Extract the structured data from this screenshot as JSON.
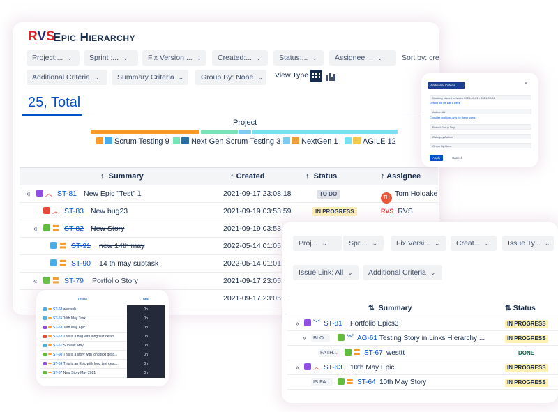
{
  "app": {
    "logo": {
      "r": "R",
      "v": "V",
      "s": "S"
    },
    "title": "Epic Hierarchy"
  },
  "filters": [
    "Project:...",
    "Sprint :...",
    "Fix Version ...",
    "Created:...",
    "Status:...",
    "Assignee ...",
    "Sort by: cre"
  ],
  "filters2": [
    "Additional Criteria",
    "Summary Criteria",
    "Group By: None"
  ],
  "view_type_label": "View Type",
  "total": "25, Total",
  "project": {
    "label": "Project",
    "legend": [
      {
        "name": "Scrum Testing",
        "count": "9",
        "color": "#f79a2a",
        "icon": "scrum-project-icon"
      },
      {
        "name": "Next Gen Scrum Testing",
        "count": "3",
        "color": "#79e2b6",
        "icon": "nextgen-scrum-project-icon"
      },
      {
        "name": "NextGen",
        "count": "1",
        "color": "#7ecbf2",
        "icon": "nextgen-project-icon"
      },
      {
        "name": "AGILE",
        "count": "12",
        "color": "#79e2f2",
        "icon": "agile-project-icon"
      }
    ]
  },
  "table": {
    "headers": {
      "summary": "Summary",
      "created": "Created",
      "status": "Status",
      "assignee": "Assignee"
    },
    "rows": [
      {
        "toggle": "«",
        "key": "ST-81",
        "summary": "New Epic \"Test\" 1",
        "created": "2021-09-17 23:08:18",
        "status": "TO DO",
        "assignee": "Tom Holoake",
        "avatar": "TH"
      },
      {
        "toggle": "",
        "key": "ST-83",
        "summary": "New bug23",
        "created": "2021-09-19 03:53:59",
        "status": "IN PROGRESS",
        "assignee": "RVS",
        "avatar": "RVS"
      },
      {
        "toggle": "«",
        "key": "ST-82",
        "summary": "New Story",
        "created": "2021-09-19 03:53:51",
        "status": "",
        "assignee": "",
        "avatar": ""
      },
      {
        "toggle": "",
        "key": "ST-91",
        "summary": "new 14th may",
        "created": "2022-05-14 01:05:03",
        "status": "",
        "assignee": "",
        "avatar": ""
      },
      {
        "toggle": "",
        "key": "ST-90",
        "summary": "14 th may subtask",
        "created": "2022-05-14 01:01:43",
        "status": "",
        "assignee": "",
        "avatar": ""
      },
      {
        "toggle": "«",
        "key": "ST-79",
        "summary": "Portfolio Story",
        "created": "2021-09-17 23:05:29",
        "status": "",
        "assignee": "",
        "avatar": ""
      },
      {
        "toggle": "",
        "key": "",
        "summary": "",
        "created": "2021-09-17 23:05:54",
        "status": "",
        "assignee": "",
        "avatar": ""
      }
    ]
  },
  "side_panel": {
    "header": "Additional Criteria",
    "close": "×",
    "fields": [
      "Working started between 2021-09-21 - 2021-09-26",
      "Author: All",
      "Period Group Day",
      "Category Author",
      "Group By:None"
    ],
    "links": [
      "Default will be last 1 week",
      "Consider worklogs only for these users"
    ],
    "apply": "Apply",
    "cancel": "Cancel"
  },
  "small_table": {
    "headers": {
      "issue": "Issue",
      "total": "Total"
    },
    "rows": [
      {
        "key": "ST-68",
        "text": "westsub",
        "total": "0h",
        "color": "#4bade8"
      },
      {
        "key": "ST-65",
        "text": "10th May Task",
        "total": "0h",
        "color": "#4bade8"
      },
      {
        "key": "ST-63",
        "text": "10th May Epic",
        "total": "0h",
        "color": "#904ee2"
      },
      {
        "key": "ST-62",
        "text": "This is a bug with long text descri...",
        "total": "0h",
        "color": "#e5493a"
      },
      {
        "key": "ST-61",
        "text": "Subtask May",
        "total": "0h",
        "color": "#4bade8"
      },
      {
        "key": "ST-60",
        "text": "This is a story with long text desc...",
        "total": "0h",
        "color": "#63ba3c"
      },
      {
        "key": "ST-59",
        "text": "This is an Epic with long text desc...",
        "total": "0h",
        "color": "#904ee2"
      },
      {
        "key": "ST-57",
        "text": "New Story May 2021",
        "total": "0h",
        "color": "#63ba3c"
      }
    ]
  },
  "right_panel": {
    "filters": [
      "Proj...",
      "Spri...",
      "Fix Versi...",
      "Creat...",
      "Issue Ty..."
    ],
    "filters2": [
      "Issue Link: All",
      "Additional Criteria"
    ],
    "headers": {
      "summary": "Summary",
      "status": "Status"
    },
    "rows": [
      {
        "toggle": "«",
        "link": "",
        "key": "ST-81",
        "summary": "Portfolio Epics3",
        "status": "IN PROGRESS"
      },
      {
        "toggle": "«",
        "link": "BLO...",
        "key": "AG-61",
        "summary": "Testing Story in Links Hierarchy ...",
        "status": "IN PROGRESS"
      },
      {
        "toggle": "",
        "link": "FATH...",
        "key": "ST-67",
        "summary": "westtt",
        "status": "DONE"
      },
      {
        "toggle": "«",
        "link": "",
        "key": "ST-63",
        "summary": "10th May Epic",
        "status": "IN PROGRESS"
      },
      {
        "toggle": "",
        "link": "IS FA...",
        "key": "ST-64",
        "summary": "10th May Story",
        "status": "IN PROGRESS"
      }
    ]
  }
}
